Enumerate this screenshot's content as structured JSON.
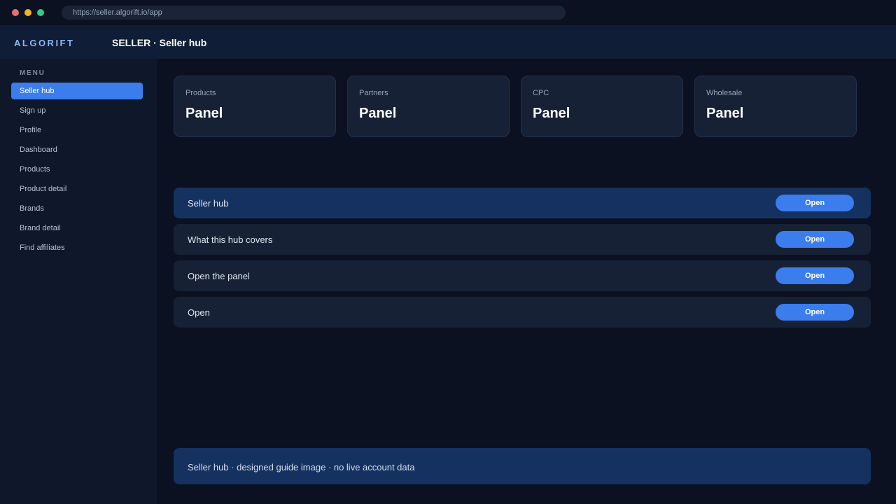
{
  "browser": {
    "url": "https://seller.algorift.io/app"
  },
  "header": {
    "brand": "ALGORIFT",
    "title": "SELLER · Seller hub"
  },
  "sidebar": {
    "heading": "MENU",
    "items": [
      {
        "label": "Seller hub",
        "active": true
      },
      {
        "label": "Sign up"
      },
      {
        "label": "Profile"
      },
      {
        "label": "Dashboard"
      },
      {
        "label": "Products"
      },
      {
        "label": "Product detail"
      },
      {
        "label": "Brands"
      },
      {
        "label": "Brand detail"
      },
      {
        "label": "Find affiliates"
      }
    ]
  },
  "cards": [
    {
      "label": "Products",
      "value": "Panel"
    },
    {
      "label": "Partners",
      "value": "Panel"
    },
    {
      "label": "CPC",
      "value": "Panel"
    },
    {
      "label": "Wholesale",
      "value": "Panel"
    }
  ],
  "rows": [
    {
      "label": "Seller hub",
      "button": "Open",
      "highlighted": true
    },
    {
      "label": "What this hub covers",
      "button": "Open"
    },
    {
      "label": "Open the panel",
      "button": "Open"
    },
    {
      "label": "Open",
      "button": "Open"
    }
  ],
  "footer": {
    "note": "Seller hub · designed guide image · no live account data"
  },
  "colors": {
    "accent": "#3b7ded",
    "background": "#0b1120",
    "header": "#0f1d36",
    "sidebar": "#0f172a",
    "card": "#172136",
    "highlight": "#153160"
  }
}
